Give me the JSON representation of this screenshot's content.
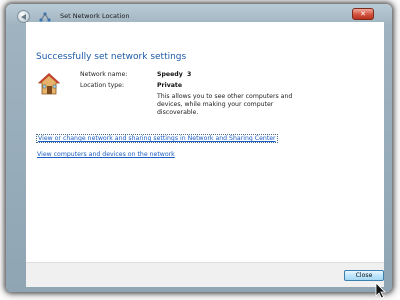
{
  "window": {
    "title": "Set Network Location"
  },
  "main": {
    "heading": "Successfully set network settings",
    "network_name_label": "Network name:",
    "network_name_value": "Speedy  3",
    "location_type_label": "Location type:",
    "location_type_value": "Private",
    "description": "This allows you to see other computers and devices, while making your computer discoverable.",
    "links": [
      "View or change network and sharing settings in Network and Sharing Center",
      "View computers and devices on the network"
    ]
  },
  "footer": {
    "close_label": "Close"
  },
  "icons": {
    "back": "back-arrow-icon",
    "network": "network-icon",
    "house": "house-icon",
    "window_close": "close-icon",
    "cursor": "mouse-cursor-icon"
  },
  "colors": {
    "heading": "#1e5aa8",
    "link": "#1a5ec4",
    "frame": "#9fb3c0"
  }
}
